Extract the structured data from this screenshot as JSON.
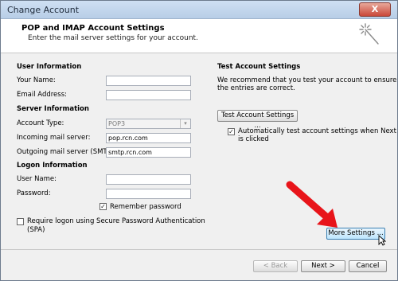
{
  "window": {
    "title": "Change Account",
    "close_glyph": "X"
  },
  "header": {
    "title": "POP and IMAP Account Settings",
    "subtitle": "Enter the mail server settings for your account."
  },
  "user_info": {
    "heading": "User Information",
    "your_name_label": "Your Name:",
    "your_name_value": "",
    "email_label": "Email Address:",
    "email_value": ""
  },
  "server_info": {
    "heading": "Server Information",
    "account_type_label": "Account Type:",
    "account_type_value": "POP3",
    "incoming_label": "Incoming mail server:",
    "incoming_value": "pop.rcn.com",
    "outgoing_label": "Outgoing mail server (SMTP):",
    "outgoing_value": "smtp.rcn.com"
  },
  "logon_info": {
    "heading": "Logon Information",
    "username_label": "User Name:",
    "username_value": "",
    "password_label": "Password:",
    "password_value": "",
    "remember_label": "Remember password",
    "remember_checked": true,
    "spa_label_line1": "Require logon using Secure Password Authentication",
    "spa_label_line2": "(SPA)",
    "spa_checked": false
  },
  "test_settings": {
    "heading": "Test Account Settings",
    "desc_line1": "We recommend that you test your account to ensure that",
    "desc_line2": "the entries are correct.",
    "test_button": "Test Account Settings ...",
    "auto_test_line1": "Automatically test account settings when Next",
    "auto_test_line2": "is clicked",
    "auto_test_checked": true
  },
  "more_settings_button": "More Settings ...",
  "footer": {
    "back_button": "< Back",
    "next_button": "Next >",
    "cancel_button": "Cancel"
  },
  "colors": {
    "arrow": "#e8141a",
    "accent": "#3c7fb1"
  }
}
